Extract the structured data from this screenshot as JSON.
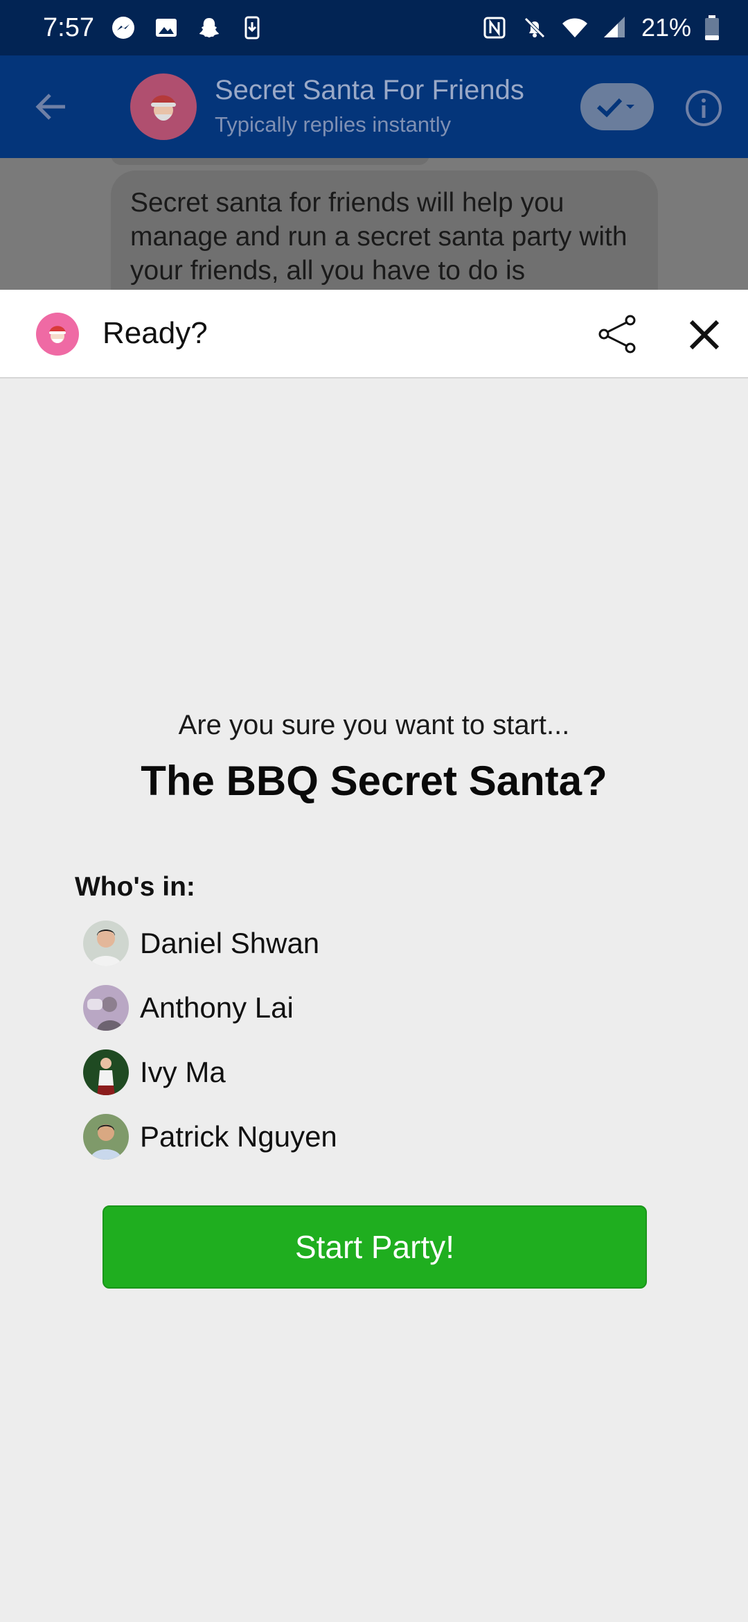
{
  "status_bar": {
    "time": "7:57",
    "battery_pct": "21%",
    "left_icons": [
      "messenger-icon",
      "image-icon",
      "snapchat-icon",
      "download-icon"
    ],
    "right_icons": [
      "nfc-icon",
      "mute-icon",
      "wifi-icon",
      "signal-icon",
      "battery-icon"
    ]
  },
  "chat_header": {
    "title": "Secret Santa For Friends",
    "subtitle": "Typically replies instantly"
  },
  "chat": {
    "message": "Secret santa for friends will help you manage and run a secret santa party with your friends, all you have to do is"
  },
  "sheet": {
    "title": "Ready?"
  },
  "content": {
    "question": "Are you sure you want to start...",
    "party_title": "The BBQ Secret Santa?",
    "whos_in_label": "Who's in:",
    "participants": [
      {
        "name": "Daniel Shwan"
      },
      {
        "name": "Anthony Lai"
      },
      {
        "name": "Ivy Ma"
      },
      {
        "name": "Patrick Nguyen"
      }
    ],
    "start_button": "Start Party!"
  },
  "colors": {
    "status_bar": "#022454",
    "header": "#04357a",
    "start_button": "#1fae1f",
    "background": "#ededed"
  }
}
